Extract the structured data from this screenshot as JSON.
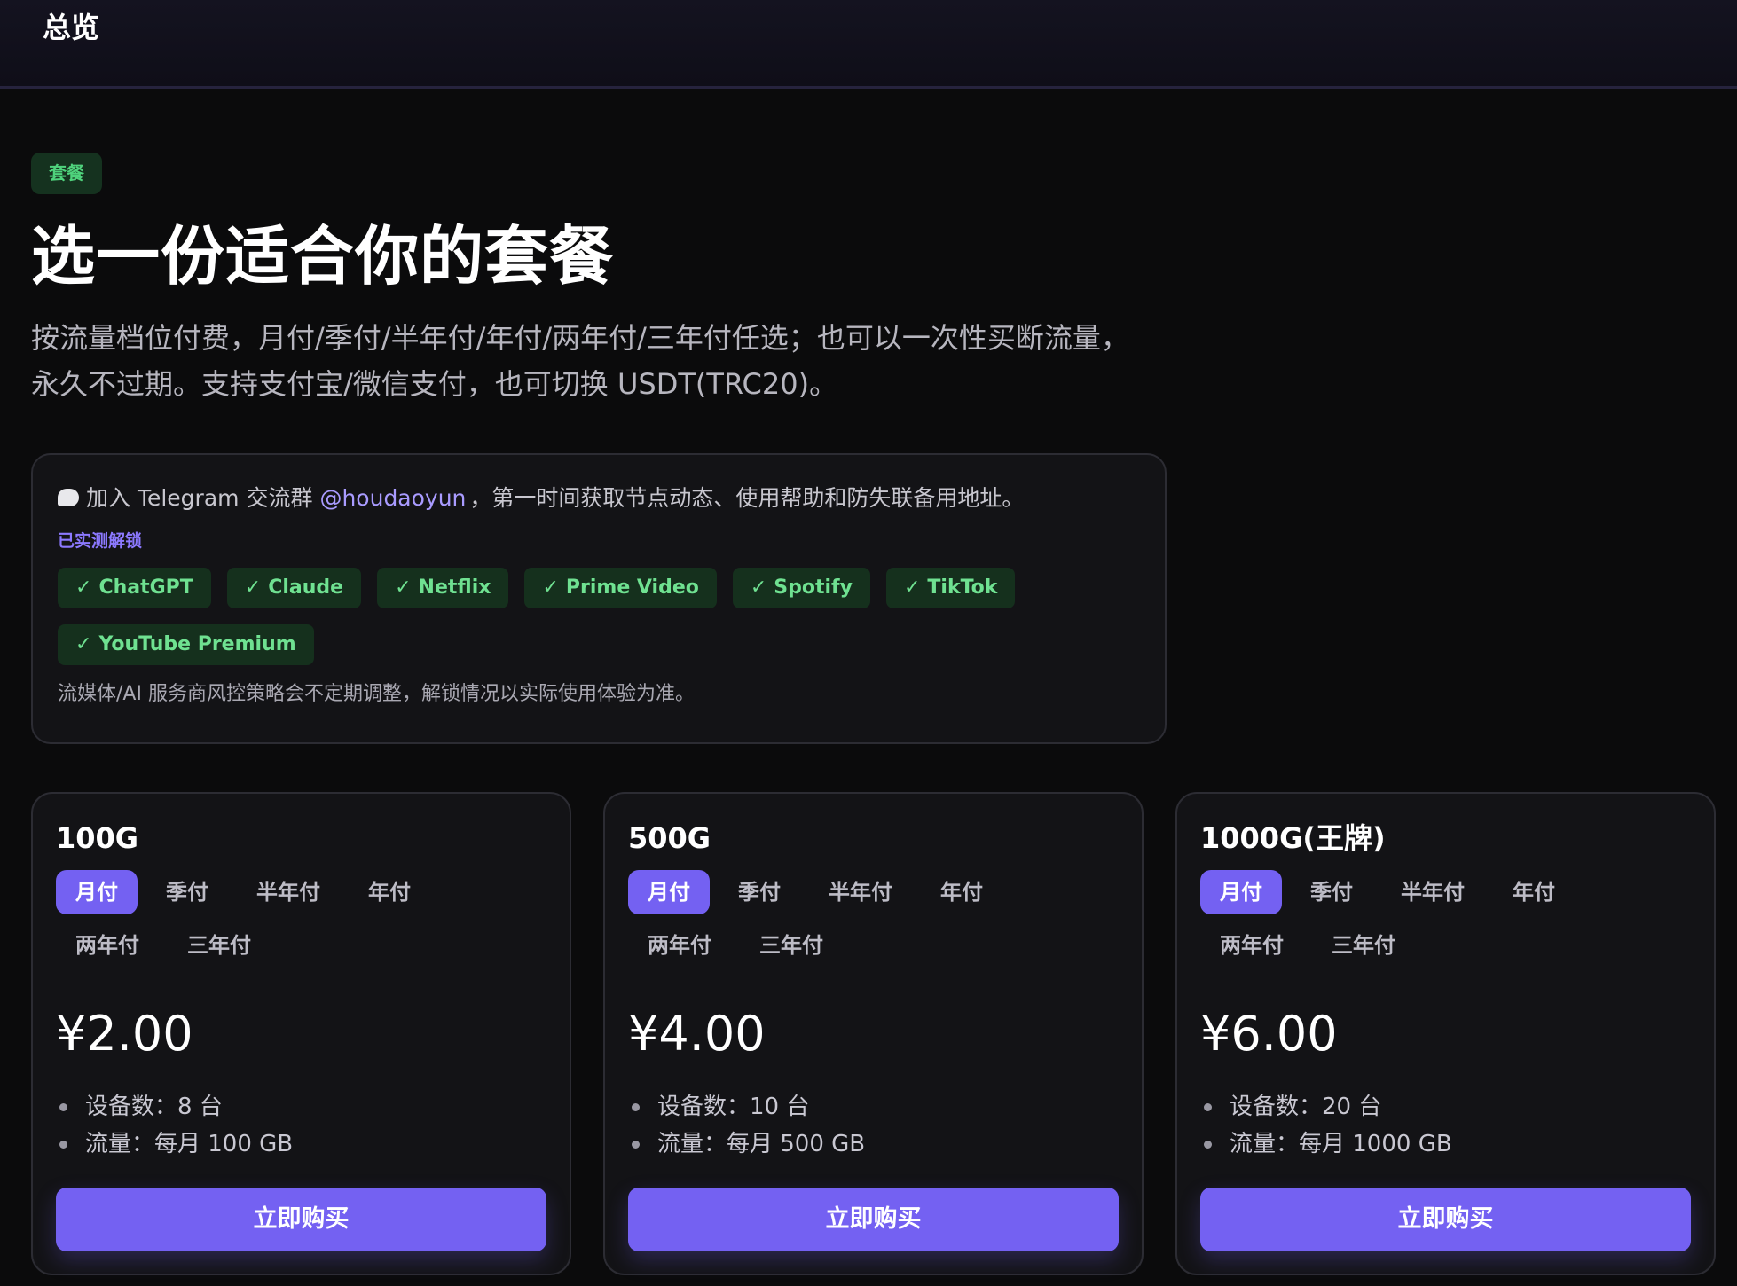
{
  "header": {
    "title": "总览"
  },
  "section": {
    "tag": "套餐",
    "heading": "选一份适合你的套餐",
    "subtitle": "按流量档位付费，月付/季付/半年付/年付/两年付/三年付任选；也可以一次性买断流量，永久不过期。支持支付宝/微信支付，也可切换 USDT(TRC20)。"
  },
  "notice": {
    "tg_prefix": "加入 Telegram 交流群",
    "tg_link": "@houdaoyun",
    "tg_suffix": "，第一时间获取节点动态、使用帮助和防失联备用地址。",
    "unlock_label": "已实测解锁",
    "check_mark": "✓",
    "services": [
      "ChatGPT",
      "Claude",
      "Netflix",
      "Prime Video",
      "Spotify",
      "TikTok",
      "YouTube Premium"
    ],
    "disclaimer": "流媒体/AI 服务商风控策略会不定期调整，解锁情况以实际使用体验为准。"
  },
  "periods": [
    "月付",
    "季付",
    "半年付",
    "年付",
    "两年付",
    "三年付"
  ],
  "plans": [
    {
      "name": "100G",
      "selected_period": "月付",
      "price": "¥2.00",
      "features": [
        "设备数：8 台",
        "流量：每月 100 GB"
      ],
      "buy_label": "立即购买"
    },
    {
      "name": "500G",
      "selected_period": "月付",
      "price": "¥4.00",
      "features": [
        "设备数：10 台",
        "流量：每月 500 GB"
      ],
      "buy_label": "立即购买"
    },
    {
      "name": "1000G(王牌)",
      "selected_period": "月付",
      "price": "¥6.00",
      "features": [
        "设备数：20 台",
        "流量：每月 1000 GB"
      ],
      "buy_label": "立即购买"
    }
  ],
  "colors": {
    "accent": "#7461f2",
    "tag_text": "#4fd27c",
    "chip_text": "#6fe191",
    "link": "#a99bff",
    "background": "#0b0b0c",
    "card": "#131316"
  },
  "icons": {
    "telegram_bubble": "speech-bubble-icon",
    "check": "check-icon",
    "bullet": "bullet-dot-icon"
  }
}
